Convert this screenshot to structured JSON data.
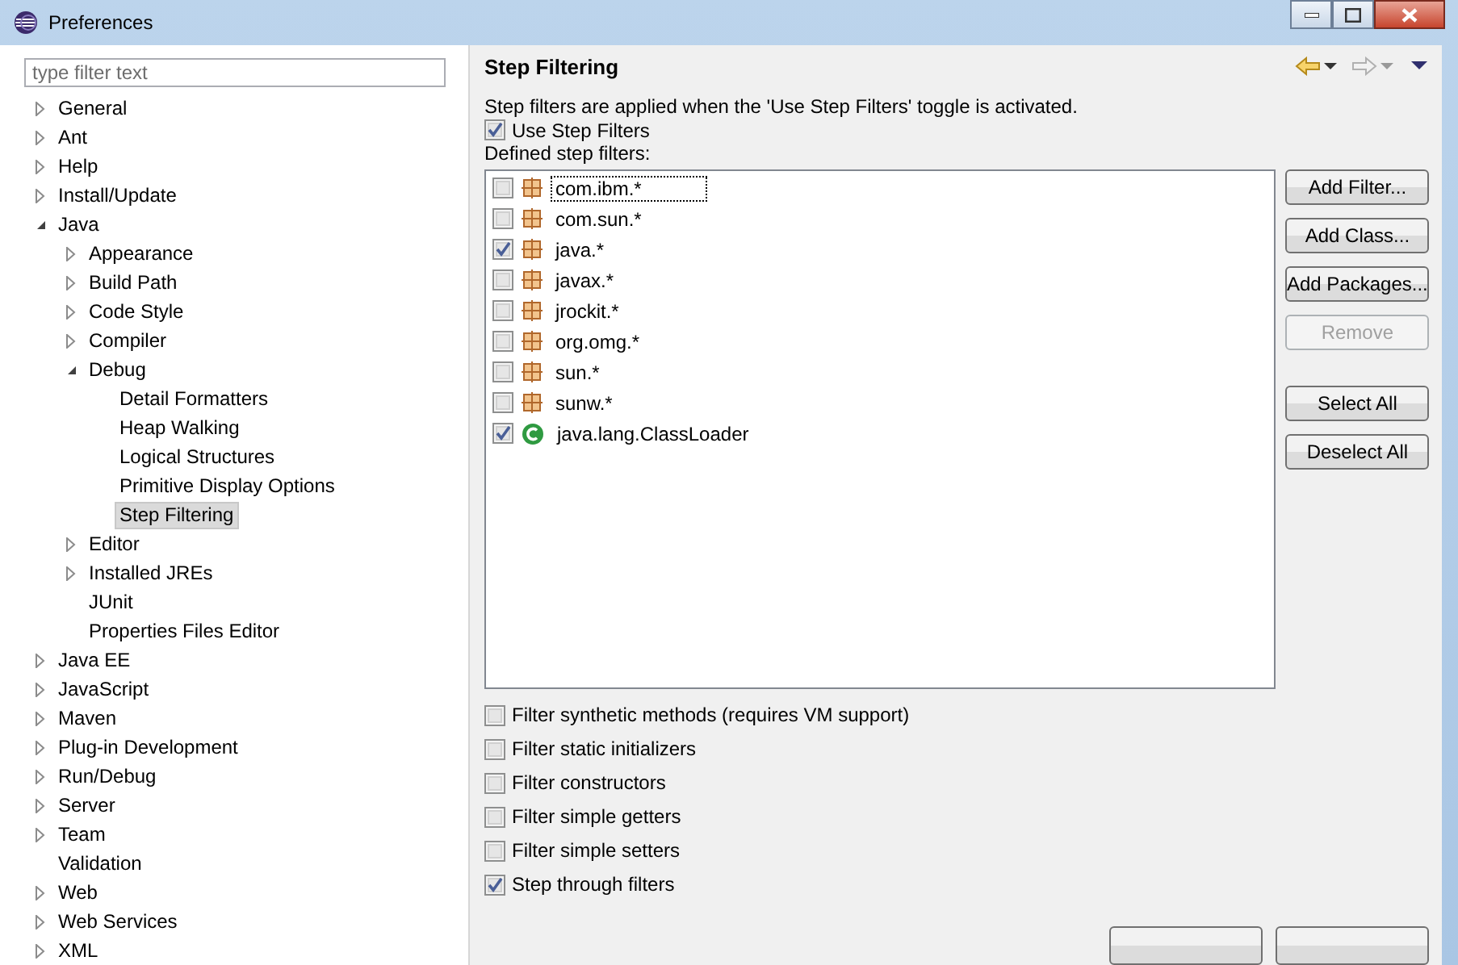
{
  "window": {
    "title": "Preferences"
  },
  "filter": {
    "placeholder": "type filter text"
  },
  "tree": [
    {
      "label": "General",
      "expanded": false,
      "selected": false
    },
    {
      "label": "Ant",
      "expanded": false,
      "selected": false
    },
    {
      "label": "Help",
      "expanded": false,
      "selected": false
    },
    {
      "label": "Install/Update",
      "expanded": false,
      "selected": false
    },
    {
      "label": "Java",
      "expanded": true,
      "selected": false,
      "children": [
        {
          "label": "Appearance",
          "expanded": false,
          "selected": false
        },
        {
          "label": "Build Path",
          "expanded": false,
          "selected": false
        },
        {
          "label": "Code Style",
          "expanded": false,
          "selected": false
        },
        {
          "label": "Compiler",
          "expanded": false,
          "selected": false
        },
        {
          "label": "Debug",
          "expanded": true,
          "selected": false,
          "children": [
            {
              "label": "Detail Formatters",
              "selected": false
            },
            {
              "label": "Heap Walking",
              "selected": false
            },
            {
              "label": "Logical Structures",
              "selected": false
            },
            {
              "label": "Primitive Display Options",
              "selected": false
            },
            {
              "label": "Step Filtering",
              "selected": true
            }
          ]
        },
        {
          "label": "Editor",
          "expanded": false,
          "selected": false
        },
        {
          "label": "Installed JREs",
          "expanded": false,
          "selected": false
        },
        {
          "label": "JUnit",
          "selected": false
        },
        {
          "label": "Properties Files Editor",
          "selected": false
        }
      ]
    },
    {
      "label": "Java EE",
      "expanded": false,
      "selected": false
    },
    {
      "label": "JavaScript",
      "expanded": false,
      "selected": false
    },
    {
      "label": "Maven",
      "expanded": false,
      "selected": false
    },
    {
      "label": "Plug-in Development",
      "expanded": false,
      "selected": false
    },
    {
      "label": "Run/Debug",
      "expanded": false,
      "selected": false
    },
    {
      "label": "Server",
      "expanded": false,
      "selected": false
    },
    {
      "label": "Team",
      "expanded": false,
      "selected": false
    },
    {
      "label": "Validation",
      "selected": false
    },
    {
      "label": "Web",
      "expanded": false,
      "selected": false
    },
    {
      "label": "Web Services",
      "expanded": false,
      "selected": false
    },
    {
      "label": "XML",
      "expanded": false,
      "selected": false
    }
  ],
  "page": {
    "title": "Step Filtering",
    "description": "Step filters are applied when the 'Use Step Filters' toggle is activated.",
    "use_step_filters": {
      "label": "Use Step Filters",
      "checked": true
    },
    "list_label": "Defined step filters:",
    "filters": [
      {
        "name": "com.ibm.*",
        "kind": "package",
        "checked": false,
        "focused": true
      },
      {
        "name": "com.sun.*",
        "kind": "package",
        "checked": false,
        "focused": false
      },
      {
        "name": "java.*",
        "kind": "package",
        "checked": true,
        "focused": false
      },
      {
        "name": "javax.*",
        "kind": "package",
        "checked": false,
        "focused": false
      },
      {
        "name": "jrockit.*",
        "kind": "package",
        "checked": false,
        "focused": false
      },
      {
        "name": "org.omg.*",
        "kind": "package",
        "checked": false,
        "focused": false
      },
      {
        "name": "sun.*",
        "kind": "package",
        "checked": false,
        "focused": false
      },
      {
        "name": "sunw.*",
        "kind": "package",
        "checked": false,
        "focused": false
      },
      {
        "name": "java.lang.ClassLoader",
        "kind": "class",
        "checked": true,
        "focused": false
      }
    ],
    "buttons": [
      {
        "label": "Add Filter...",
        "disabled": false
      },
      {
        "label": "Add Class...",
        "disabled": false
      },
      {
        "label": "Add Packages...",
        "disabled": false
      },
      {
        "label": "Remove",
        "disabled": true
      },
      {
        "label": "Select All",
        "disabled": false
      },
      {
        "label": "Deselect All",
        "disabled": false
      }
    ],
    "options": [
      {
        "label": "Filter synthetic methods (requires VM support)",
        "checked": false
      },
      {
        "label": "Filter static initializers",
        "checked": false
      },
      {
        "label": "Filter constructors",
        "checked": false
      },
      {
        "label": "Filter simple getters",
        "checked": false
      },
      {
        "label": "Filter simple setters",
        "checked": false
      },
      {
        "label": "Step through filters",
        "checked": true
      }
    ]
  }
}
